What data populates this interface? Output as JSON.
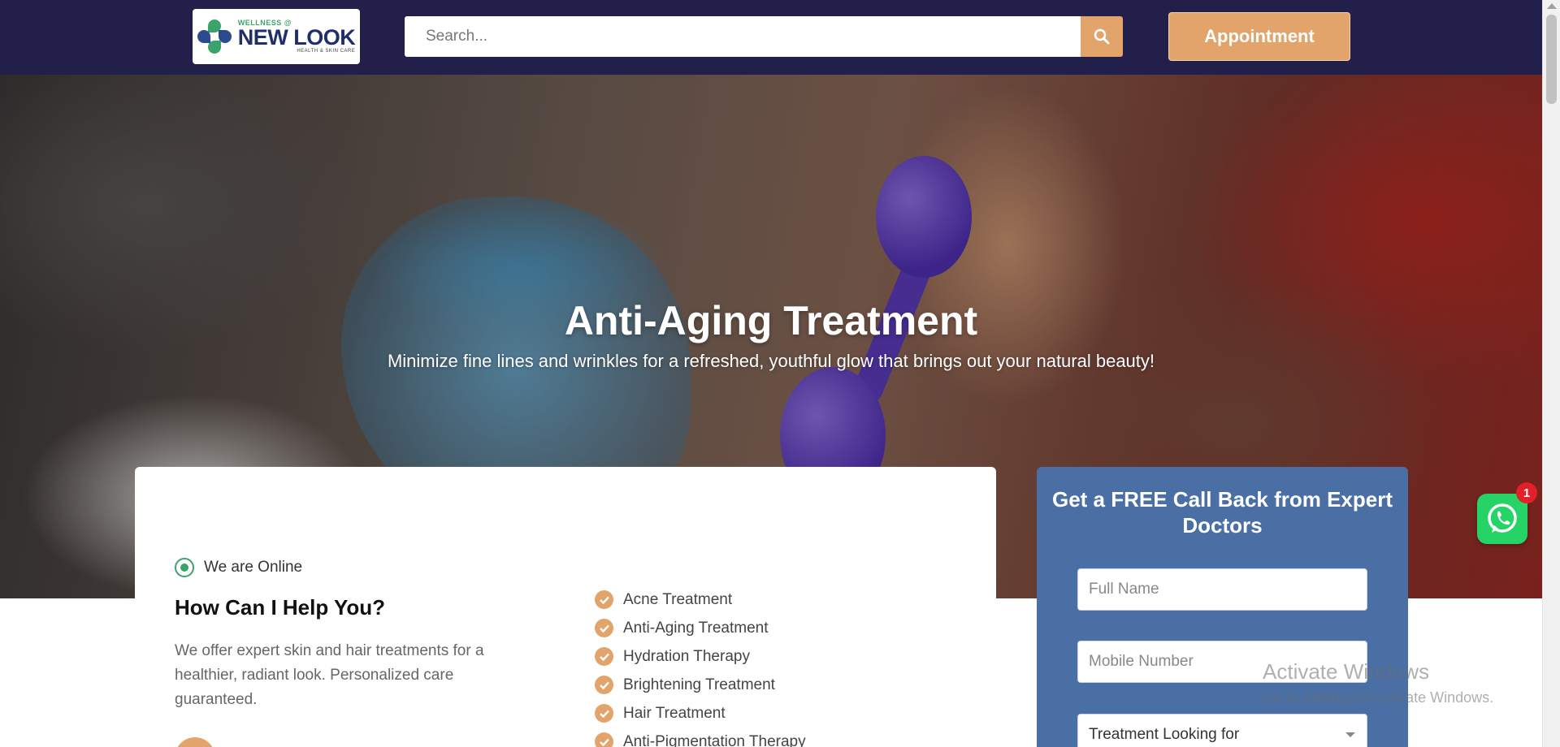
{
  "header": {
    "logo": {
      "top": "WELLNESS @",
      "main": "NEW LOOK",
      "sub": "HEALTH & SKIN CARE"
    },
    "search": {
      "placeholder": "Search...",
      "icon": "search-icon"
    },
    "appointment_label": "Appointment",
    "colors": {
      "bg": "#22204a",
      "accent": "#e2a46a"
    }
  },
  "hero": {
    "title": "Anti-Aging Treatment",
    "subtitle": "Minimize fine lines and wrinkles for a refreshed, youthful glow that brings out your natural beauty!"
  },
  "help": {
    "status": "We are Online",
    "title": "How Can I Help You?",
    "description": "We offer expert skin and hair treatments for a healthier, radiant look. Personalized care guaranteed.",
    "treatments": [
      "Acne Treatment",
      "Anti-Aging Treatment",
      "Hydration Therapy",
      "Brightening Treatment",
      "Hair Treatment",
      "Anti-Pigmentation Therapy"
    ]
  },
  "callback": {
    "title": "Get a FREE Call Back from Expert Doctors",
    "full_name_placeholder": "Full Name",
    "mobile_placeholder": "Mobile Number",
    "treatment_select": "Treatment Looking for",
    "color": "#4a6fa5"
  },
  "watermark": {
    "line1": "Activate Windows",
    "line2": "Go to Settings to activate Windows."
  },
  "whatsapp": {
    "badge": "1",
    "icon": "whatsapp-icon"
  }
}
